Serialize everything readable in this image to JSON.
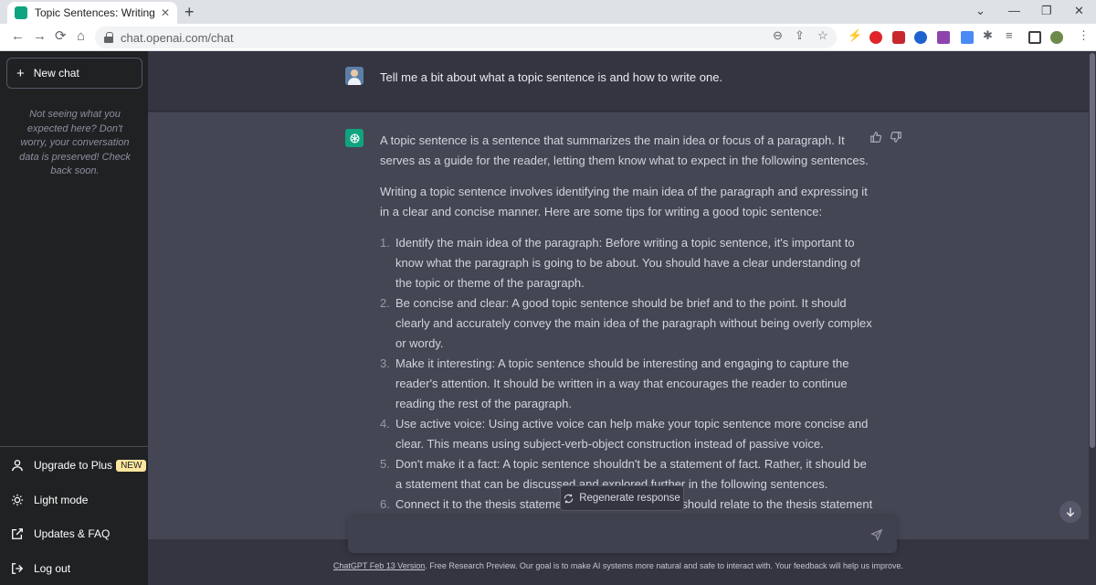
{
  "browser": {
    "tab_title": "Topic Sentences: Writing Tips.",
    "tab_close": "✕",
    "new_tab": "+",
    "url": "chat.openai.com/chat",
    "back": "←",
    "forward": "→",
    "reload": "⟳",
    "home": "⌂",
    "window_minimize": "—",
    "window_restore": "❐",
    "window_close": "✕",
    "chevron": "⌄",
    "zoom": "⊖",
    "share": "⇪",
    "bookmark": "☆",
    "menu": "⋮"
  },
  "sidebar": {
    "new_chat_icon": "+",
    "new_chat": "New chat",
    "hint": "Not seeing what you expected here? Don't worry, your conversation data is preserved! Check back soon.",
    "items": [
      {
        "label": "Upgrade to Plus",
        "badge": "NEW",
        "icon": "user-icon"
      },
      {
        "label": "Light mode",
        "icon": "sun-icon"
      },
      {
        "label": "Updates & FAQ",
        "icon": "external-link-icon"
      },
      {
        "label": "Log out",
        "icon": "logout-icon"
      }
    ]
  },
  "conversation": {
    "user_message": "Tell me a bit about what a topic sentence is and how to write one.",
    "bot_para1": "A topic sentence is a sentence that summarizes the main idea or focus of a paragraph. It serves as a guide for the reader, letting them know what to expect in the following sentences.",
    "bot_para2": "Writing a topic sentence involves identifying the main idea of the paragraph and expressing it in a clear and concise manner. Here are some tips for writing a good topic sentence:",
    "tips": [
      {
        "num": "1.",
        "text": "Identify the main idea of the paragraph: Before writing a topic sentence, it's important to know what the paragraph is going to be about. You should have a clear understanding of the topic or theme of the paragraph."
      },
      {
        "num": "2.",
        "text": "Be concise and clear: A good topic sentence should be brief and to the point. It should clearly and accurately convey the main idea of the paragraph without being overly complex or wordy."
      },
      {
        "num": "3.",
        "text": "Make it interesting: A topic sentence should be interesting and engaging to capture the reader's attention. It should be written in a way that encourages the reader to continue reading the rest of the paragraph."
      },
      {
        "num": "4.",
        "text": "Use active voice: Using active voice can help make your topic sentence more concise and clear. This means using subject-verb-object construction instead of passive voice."
      },
      {
        "num": "5.",
        "text": "Don't make it a fact: A topic sentence shouldn't be a statement of fact. Rather, it should be a statement that can be discussed and explored further in the following sentences."
      },
      {
        "num": "6.",
        "text": "Connect it to the thesis statement: The topic sentence should relate to the thesis statement"
      }
    ]
  },
  "controls": {
    "regenerate": "Regenerate response",
    "prompt_placeholder": ""
  },
  "footer": {
    "version_link": "ChatGPT Feb 13 Version",
    "text": ". Free Research Preview. Our goal is to make AI systems more natural and safe to interact with. Your feedback will help us improve."
  },
  "colors": {
    "sidebar_bg": "#202123",
    "main_bg": "#343541",
    "bot_bg": "#444654",
    "accent": "#10a37f",
    "badge_bg": "#fae69e"
  }
}
